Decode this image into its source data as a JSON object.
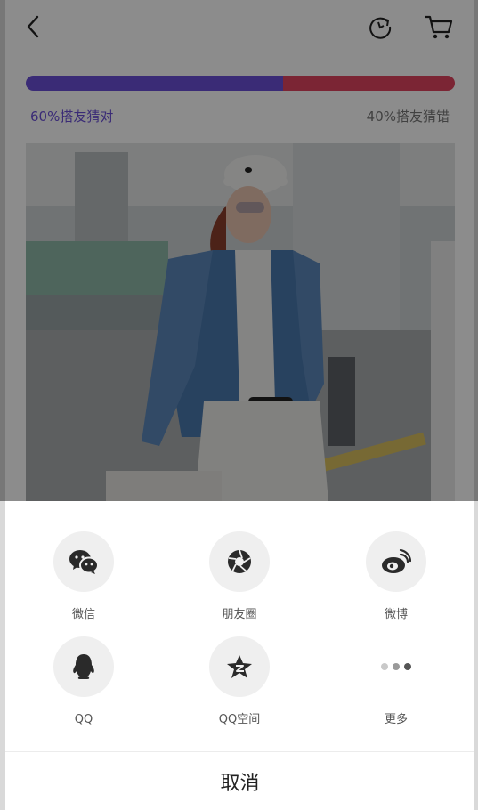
{
  "vote": {
    "right_fraction": 0.6,
    "wrong_fraction": 0.4,
    "right_label": "60%搭友猜对",
    "wrong_label": "40%搭友猜错",
    "right_color": "#6b4fd8",
    "wrong_color": "#e0445f"
  },
  "header": {
    "back_icon": "chevron-left-icon",
    "refresh_icon": "refresh-icon",
    "cart_icon": "cart-icon"
  },
  "photo": {
    "subject": "woman in white cap and denim jacket at airport"
  },
  "share": {
    "items": [
      {
        "label": "微信",
        "icon": "wechat-icon"
      },
      {
        "label": "朋友圈",
        "icon": "moments-icon"
      },
      {
        "label": "微博",
        "icon": "weibo-icon"
      },
      {
        "label": "QQ",
        "icon": "qq-icon"
      },
      {
        "label": "QQ空间",
        "icon": "qzone-icon"
      },
      {
        "label": "更多",
        "icon": "more-icon"
      }
    ],
    "cancel_label": "取消"
  }
}
